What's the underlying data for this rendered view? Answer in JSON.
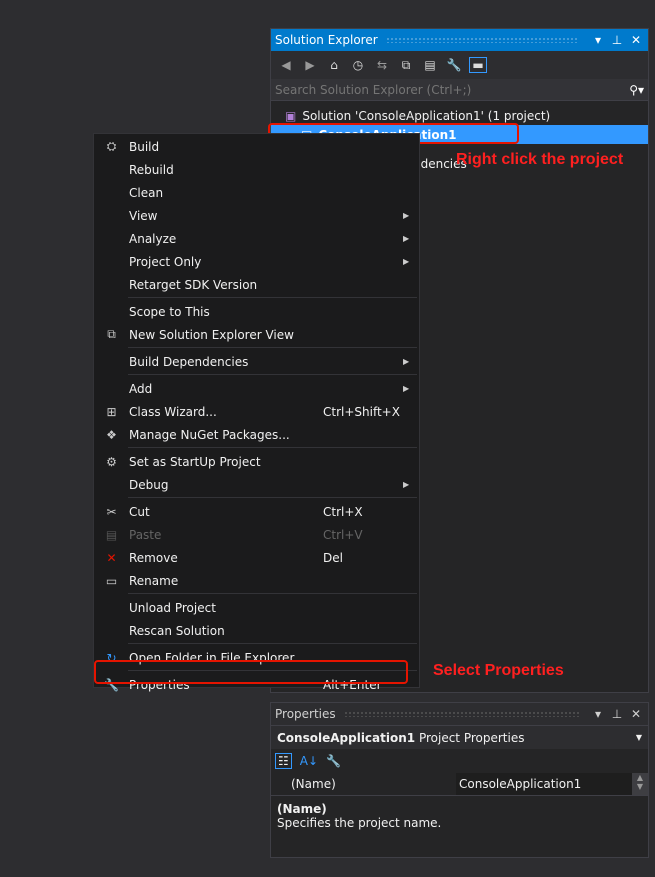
{
  "solution_explorer": {
    "title": "Solution Explorer",
    "search_placeholder": "Search Solution Explorer (Ctrl+;)",
    "solution_label": "Solution 'ConsoleApplication1' (1 project)",
    "project_label": "ConsoleApplication1",
    "dependencies_partial": "ndencies"
  },
  "annotations": {
    "right_click": "Right click the project",
    "select_properties": "Select Properties"
  },
  "menu": [
    {
      "label": "Build",
      "icon": "build-icon",
      "glyph": "⛭"
    },
    {
      "label": "Rebuild"
    },
    {
      "label": "Clean"
    },
    {
      "label": "View",
      "submenu": true
    },
    {
      "label": "Analyze",
      "submenu": true
    },
    {
      "label": "Project Only",
      "submenu": true
    },
    {
      "label": "Retarget SDK Version"
    },
    {
      "sep": true
    },
    {
      "label": "Scope to This"
    },
    {
      "label": "New Solution Explorer View",
      "icon": "new-view-icon",
      "glyph": "⧉"
    },
    {
      "sep": true
    },
    {
      "label": "Build Dependencies",
      "submenu": true
    },
    {
      "sep": true
    },
    {
      "label": "Add",
      "submenu": true
    },
    {
      "label": "Class Wizard...",
      "shortcut": "Ctrl+Shift+X",
      "icon": "class-wizard-icon",
      "glyph": "⊞"
    },
    {
      "label": "Manage NuGet Packages...",
      "icon": "nuget-icon",
      "glyph": "❖"
    },
    {
      "sep": true
    },
    {
      "label": "Set as StartUp Project",
      "icon": "gear-icon",
      "glyph": "⚙"
    },
    {
      "label": "Debug",
      "submenu": true
    },
    {
      "sep": true
    },
    {
      "label": "Cut",
      "shortcut": "Ctrl+X",
      "icon": "scissors-icon",
      "glyph": "✂"
    },
    {
      "label": "Paste",
      "shortcut": "Ctrl+V",
      "icon": "paste-icon",
      "glyph": "▤",
      "disabled": true
    },
    {
      "label": "Remove",
      "shortcut": "Del",
      "icon": "remove-icon",
      "glyph": "✕",
      "color": "#e51400"
    },
    {
      "label": "Rename",
      "icon": "rename-icon",
      "glyph": "▭"
    },
    {
      "sep": true
    },
    {
      "label": "Unload Project"
    },
    {
      "label": "Rescan Solution"
    },
    {
      "sep": true
    },
    {
      "label": "Open Folder in File Explorer",
      "icon": "refresh-folder-icon",
      "glyph": "↻",
      "color": "#3399ff"
    },
    {
      "sep": true
    },
    {
      "label": "Properties",
      "shortcut": "Alt+Enter",
      "icon": "wrench-icon",
      "glyph": "🔧"
    }
  ],
  "properties": {
    "title": "Properties",
    "object_name": "ConsoleApplication1",
    "object_type": "Project Properties",
    "prop_name": "(Name)",
    "prop_value": "ConsoleApplication1",
    "desc_title": "(Name)",
    "desc_text": "Specifies the project name."
  },
  "colors": {
    "accent": "#007acc",
    "selection": "#3399ff",
    "annotation": "#e51400"
  }
}
